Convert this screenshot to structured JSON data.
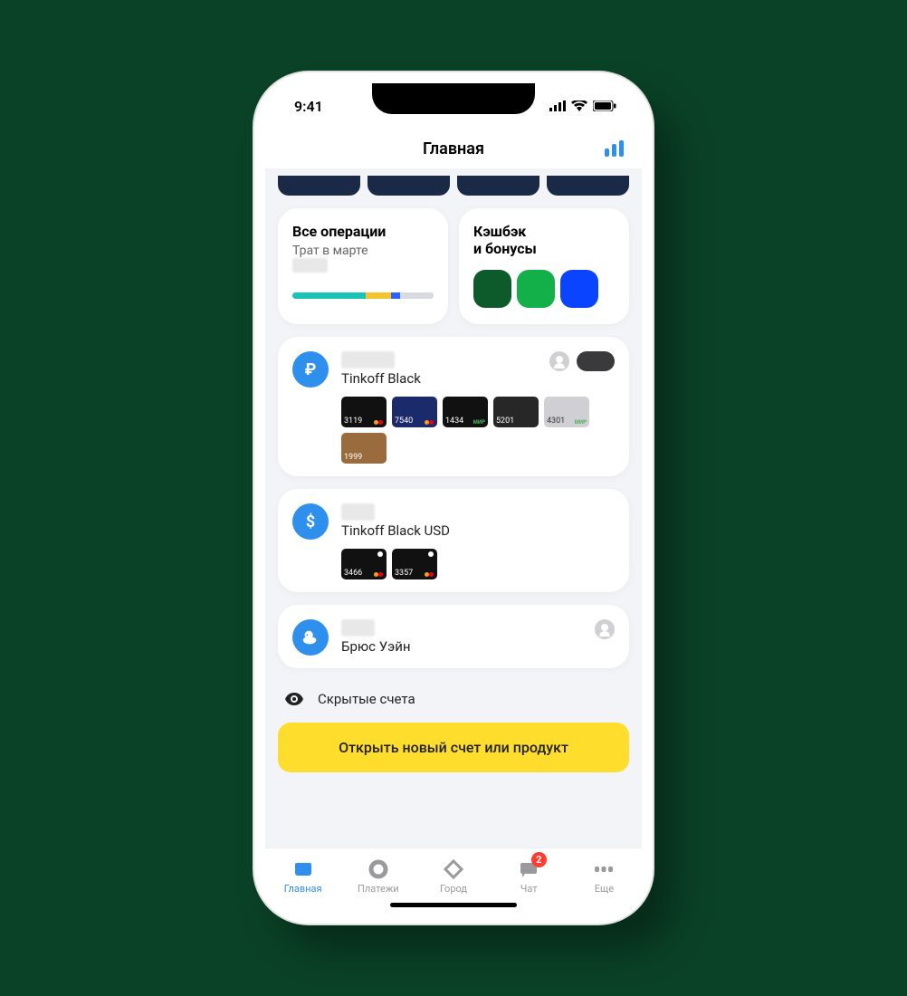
{
  "status": {
    "time": "9:41"
  },
  "header": {
    "title": "Главная"
  },
  "tiles": {
    "ops": {
      "title": "Все операции",
      "subtitle": "Трат в марте",
      "amount_hidden": "00000"
    },
    "cashback": {
      "title_line1": "Кэшбэк",
      "title_line2": "и бонусы",
      "chips": [
        "#0d5a2b",
        "#13b04a",
        "#0b44ff"
      ]
    }
  },
  "accounts": [
    {
      "icon": "₽",
      "amount_hidden": "00000 0",
      "name": "Tinkoff Black",
      "has_person": true,
      "has_toggle": true,
      "cards": [
        {
          "num": "3119",
          "bg": "#111",
          "scheme": "mc"
        },
        {
          "num": "7540",
          "bg": "#1b2a6b",
          "scheme": "mc"
        },
        {
          "num": "1434",
          "bg": "#111",
          "scheme": "mir"
        },
        {
          "num": "5201",
          "bg": "#272727",
          "scheme": "none"
        },
        {
          "num": "4301",
          "bg": "#cfcfd4",
          "scheme": "mir",
          "dark_text": true
        },
        {
          "num": "1999",
          "bg": "#9a6b3c",
          "scheme": "none"
        }
      ]
    },
    {
      "icon": "$",
      "amount_hidden": "0000",
      "name": "Tinkoff Black USD",
      "has_person": false,
      "has_toggle": false,
      "cards": [
        {
          "num": "3466",
          "bg": "#111",
          "scheme": "mc",
          "pin": true
        },
        {
          "num": "3357",
          "bg": "#111",
          "scheme": "mc",
          "pin": true
        }
      ]
    },
    {
      "icon": "duck",
      "amount_hidden": "0000",
      "name": "Брюс Уэйн",
      "has_person": true,
      "has_toggle": false,
      "cards": []
    }
  ],
  "hidden": {
    "label": "Скрытые счета"
  },
  "cta": {
    "label": "Открыть новый счет или продукт"
  },
  "tabs": [
    {
      "label": "Главная",
      "active": true,
      "icon": "home"
    },
    {
      "label": "Платежи",
      "active": false,
      "icon": "circle"
    },
    {
      "label": "Город",
      "active": false,
      "icon": "diamond"
    },
    {
      "label": "Чат",
      "active": false,
      "icon": "chat",
      "badge": "2"
    },
    {
      "label": "Еще",
      "active": false,
      "icon": "dots"
    }
  ],
  "progress": [
    {
      "color": "#19c3b8",
      "w": 52
    },
    {
      "color": "#f4c430",
      "w": 18
    },
    {
      "color": "#2962ff",
      "w": 6
    },
    {
      "color": "#d9d9e0",
      "w": 24
    }
  ]
}
